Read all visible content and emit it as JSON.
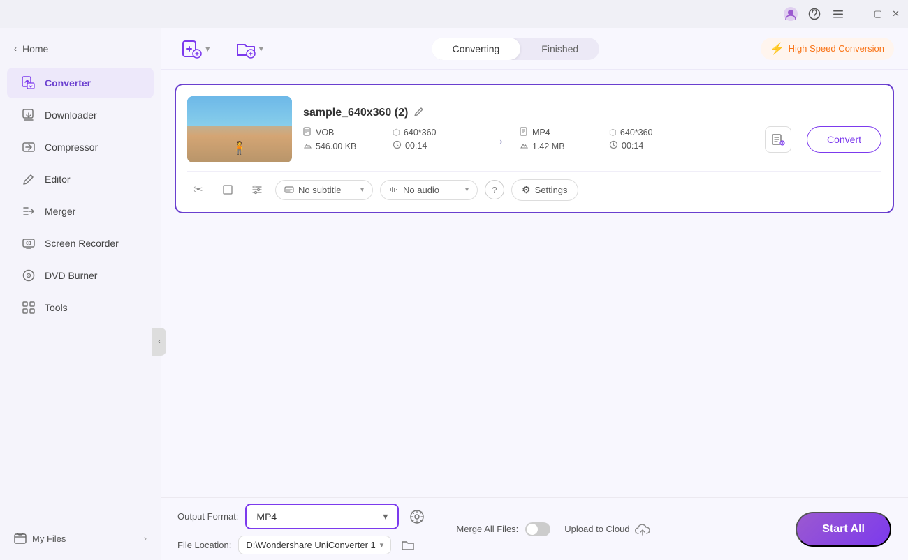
{
  "titlebar": {
    "window_controls": [
      "minimize",
      "maximize",
      "close"
    ]
  },
  "sidebar": {
    "home_label": "Home",
    "items": [
      {
        "id": "converter",
        "label": "Converter",
        "active": true
      },
      {
        "id": "downloader",
        "label": "Downloader",
        "active": false
      },
      {
        "id": "compressor",
        "label": "Compressor",
        "active": false
      },
      {
        "id": "editor",
        "label": "Editor",
        "active": false
      },
      {
        "id": "merger",
        "label": "Merger",
        "active": false
      },
      {
        "id": "screen-recorder",
        "label": "Screen Recorder",
        "active": false
      },
      {
        "id": "dvd-burner",
        "label": "DVD Burner",
        "active": false
      },
      {
        "id": "tools",
        "label": "Tools",
        "active": false
      }
    ],
    "my_files_label": "My Files"
  },
  "toolbar": {
    "tabs": [
      {
        "id": "converting",
        "label": "Converting",
        "active": true
      },
      {
        "id": "finished",
        "label": "Finished",
        "active": false
      }
    ],
    "high_speed_label": "High Speed Conversion"
  },
  "file_card": {
    "filename": "sample_640x360 (2)",
    "source": {
      "format": "VOB",
      "resolution": "640*360",
      "size": "546.00 KB",
      "duration": "00:14"
    },
    "target": {
      "format": "MP4",
      "resolution": "640*360",
      "size": "1.42 MB",
      "duration": "00:14"
    },
    "convert_button_label": "Convert",
    "subtitle_label": "No subtitle",
    "audio_label": "No audio",
    "settings_label": "Settings"
  },
  "bottom_bar": {
    "output_format_label": "Output Format:",
    "output_format_value": "MP4",
    "merge_label": "Merge All Files:",
    "file_location_label": "File Location:",
    "file_location_value": "D:\\Wondershare UniConverter 1",
    "upload_cloud_label": "Upload to Cloud",
    "start_all_label": "Start All"
  },
  "colors": {
    "accent": "#7c3aed",
    "active_tab_bg": "#ffffff",
    "tab_group_bg": "#ece9f6",
    "card_border": "#6a3fcf",
    "high_speed_color": "#f97316"
  }
}
